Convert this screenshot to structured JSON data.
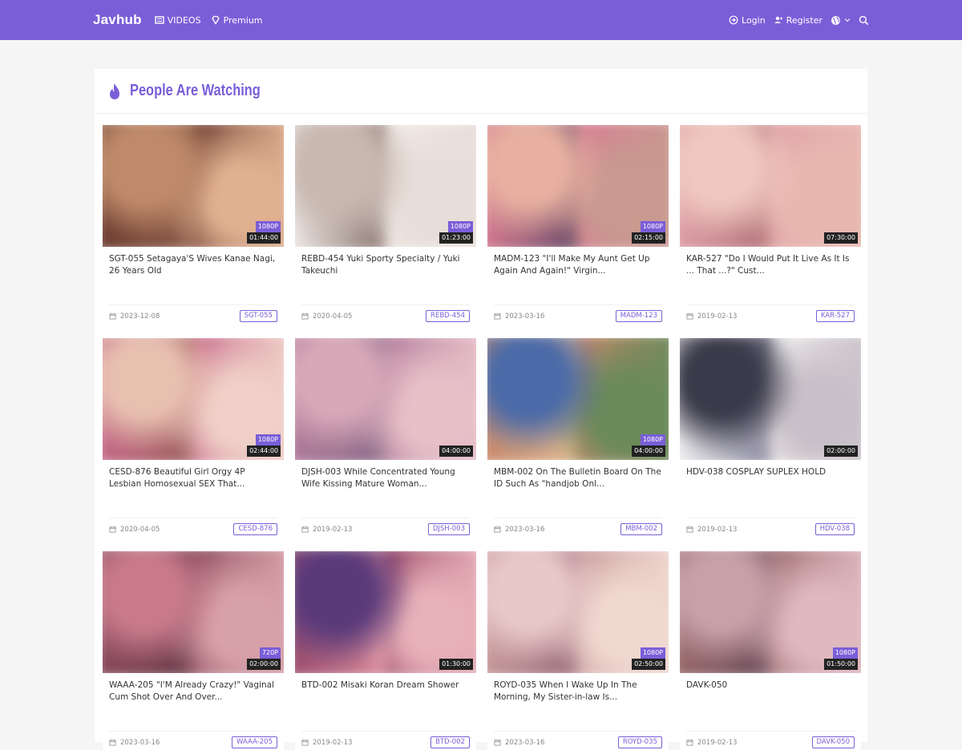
{
  "header": {
    "brand": "Javhub",
    "nav": [
      {
        "label": "VIDEOS",
        "icon": "list-icon"
      },
      {
        "label": "Premium",
        "icon": "diamond-icon"
      }
    ],
    "right": [
      {
        "label": "Login",
        "icon": "login-icon"
      },
      {
        "label": "Register",
        "icon": "user-plus-icon"
      }
    ],
    "accent": "#7a5ed8"
  },
  "section": {
    "title": "People Are Watching"
  },
  "videos": [
    {
      "title": "SGT-055 Setagaya'S Wives Kanae Nagi, 26 Years Old",
      "res": "1080P",
      "duration": "01:44:00",
      "date": "2023-12-08",
      "code": "SGT-055",
      "colors": [
        "#6b3a2e",
        "#c08a6a",
        "#8a5a48",
        "#e0b090"
      ]
    },
    {
      "title": "REBD-454 Yuki Sporty Specialty / Yuki Takeuchi",
      "res": "1080P",
      "duration": "01:23:00",
      "date": "2020-04-05",
      "code": "REBD-454",
      "colors": [
        "#f2ece8",
        "#c8b8b0",
        "#8a7670",
        "#e8ddd8"
      ]
    },
    {
      "title": "MADM-123 \"I'll Make My Aunt Get Up Again And Again!\" Virgin...",
      "res": "1080P",
      "duration": "02:15:00",
      "date": "2023-03-16",
      "code": "MADM-123",
      "colors": [
        "#d87a92",
        "#e8b0a0",
        "#6a4a68",
        "#c89a90"
      ]
    },
    {
      "title": "KAR-527 \"Do I Would Put It Live As It Is ... That ...?\" Cust...",
      "res": "",
      "duration": "07:30:00",
      "date": "2019-02-13",
      "code": "KAR-527",
      "colors": [
        "#e0a0a8",
        "#f0c8c0",
        "#b07078",
        "#e8b8b0"
      ]
    },
    {
      "title": "CESD-876 Beautiful Girl Orgy 4P Lesbian Homosexual SEX That...",
      "res": "1080P",
      "duration": "02:44:00",
      "date": "2020-04-05",
      "code": "CESD-876",
      "colors": [
        "#c86a8a",
        "#e8c0b0",
        "#9a5a5a",
        "#f0d0c8"
      ]
    },
    {
      "title": "DJSH-003 While Concentrated Young Wife Kissing Mature Woman...",
      "res": "",
      "duration": "04:00:00",
      "date": "2019-02-13",
      "code": "DJSH-003",
      "colors": [
        "#b07a9a",
        "#d8a8b8",
        "#8a6a88",
        "#e8c0c8"
      ]
    },
    {
      "title": "MBM-002 On The Bulletin Board On The ID Such As \"handjob Onl...",
      "res": "1080P",
      "duration": "04:00:00",
      "date": "2023-03-16",
      "code": "MBM-002",
      "colors": [
        "#c8886a",
        "#4a6aa8",
        "#e0b890",
        "#6a8a5a"
      ]
    },
    {
      "title": "HDV-038 COSPLAY SUPLEX HOLD",
      "res": "",
      "duration": "02:00:00",
      "date": "2019-02-13",
      "code": "HDV-038",
      "colors": [
        "#f4f2f2",
        "#3a3a4a",
        "#8a8aa0",
        "#c8c0c8"
      ]
    },
    {
      "title": "WAAA-205 \"I'M Already Crazy!\" Vaginal Cum Shot Over And Over...",
      "res": "720P",
      "duration": "02:00:00",
      "date": "2023-03-16",
      "code": "WAAA-205",
      "colors": [
        "#8a4a5a",
        "#c87a8a",
        "#6a3a4a",
        "#d8a0a8"
      ]
    },
    {
      "title": "BTD-002 Misaki Koran Dream Shower",
      "res": "",
      "duration": "01:30:00",
      "date": "2019-02-13",
      "code": "BTD-002",
      "colors": [
        "#9a4a6a",
        "#5a3a7a",
        "#d88a9a",
        "#e8b0b8"
      ]
    },
    {
      "title": "ROYD-035 When I Wake Up In The Morning, My Sister-in-law Is...",
      "res": "1080P",
      "duration": "02:50:00",
      "date": "2023-03-16",
      "code": "ROYD-035",
      "colors": [
        "#c89a9a",
        "#e8c8c8",
        "#9a6a7a",
        "#f0d8d0"
      ]
    },
    {
      "title": "DAVK-050",
      "res": "1080P",
      "duration": "01:50:00",
      "date": "2019-02-13",
      "code": "DAVK-050",
      "colors": [
        "#9a6a6a",
        "#c8a0a8",
        "#6a4a58",
        "#e0b8c0"
      ]
    }
  ]
}
